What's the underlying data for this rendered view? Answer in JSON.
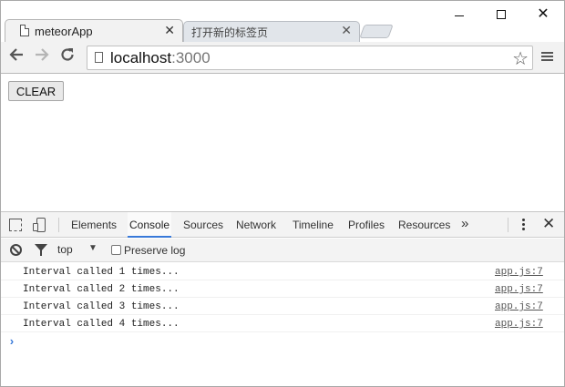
{
  "browser": {
    "tabs": [
      {
        "title": "meteorApp",
        "active": true
      },
      {
        "title": "打开新的标签页",
        "active": false
      }
    ],
    "close_glyph": "✕",
    "window_close_glyph": "✕",
    "nav": {
      "back_glyph": "🡐",
      "forward_glyph": "🡒",
      "reload_glyph": "↻"
    },
    "url": {
      "host": "localhost",
      "port": ":3000"
    },
    "star_glyph": "☆"
  },
  "page": {
    "clear_button_label": "CLEAR"
  },
  "devtools": {
    "tabs": [
      "Elements",
      "Console",
      "Sources",
      "Network",
      "Timeline",
      "Profiles",
      "Resources"
    ],
    "active_tab": "Console",
    "more_glyph": "»",
    "close_glyph": "✕",
    "context": "top",
    "context_arrow": "▼",
    "preserve_log_label": "Preserve log",
    "preserve_log_checked": false,
    "logs": [
      {
        "message": "Interval called 1 times...",
        "source": "app.js:7"
      },
      {
        "message": "Interval called 2 times...",
        "source": "app.js:7"
      },
      {
        "message": "Interval called 3 times...",
        "source": "app.js:7"
      },
      {
        "message": "Interval called 4 times...",
        "source": "app.js:7"
      }
    ],
    "prompt_glyph": "›"
  },
  "colors": {
    "accent": "#3879d9",
    "toolbar_bg": "#f2f2f2",
    "inactive_tab_bg": "#e1e5ea"
  }
}
